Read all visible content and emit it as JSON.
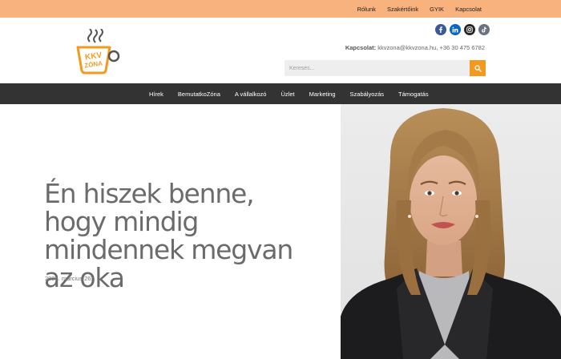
{
  "topbar": {
    "links": [
      "Rólunk",
      "Szakértőink",
      "GYIK",
      "Kapcsolat"
    ]
  },
  "logo": {
    "text_line1": "KKV",
    "text_line2": "ZÓNA"
  },
  "socials": [
    {
      "icon": "facebook-icon",
      "color": "#3b5998"
    },
    {
      "icon": "linkedin-icon",
      "color": "#0a66c2"
    },
    {
      "icon": "instagram-icon",
      "color": "#262626"
    },
    {
      "icon": "tiktok-icon",
      "color": "#69727d"
    }
  ],
  "contact": {
    "label": "Kapcsolat:",
    "value": "kkvzona@kkvzona.hu, +36 30 475 6782"
  },
  "search": {
    "placeholder": "Keresés..."
  },
  "mainnav": {
    "items": [
      "Hírek",
      "BemutatkoZóna",
      "A vállalkozó",
      "Üzlet",
      "Marketing",
      "Szabályozás",
      "Támogatás"
    ]
  },
  "article": {
    "title": "Én hiszek benne, hogy mindig mindennek megvan az oka",
    "date": "2024. március 26."
  },
  "colors": {
    "topbar": "#f7b27e",
    "accent": "#f39a1e",
    "nav": "#333333",
    "title": "#6b6b6b"
  }
}
